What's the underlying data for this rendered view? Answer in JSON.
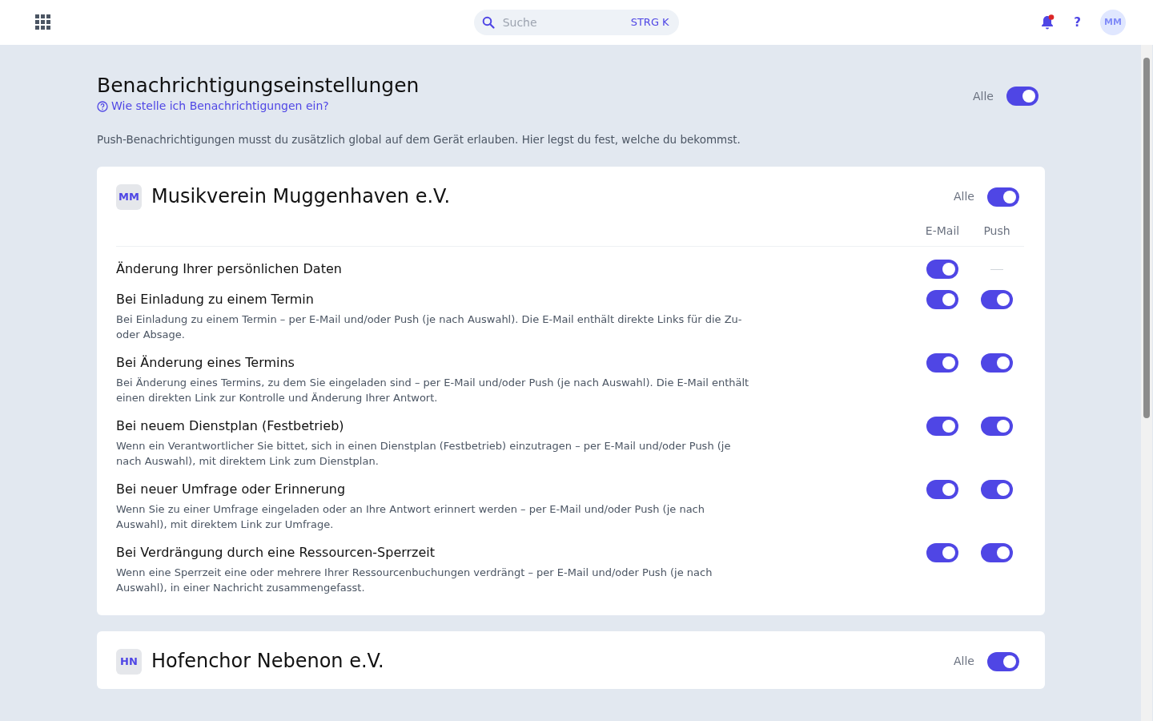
{
  "search": {
    "placeholder": "Suche",
    "shortcut": "STRG K"
  },
  "topbar": {
    "notifications_unread": true,
    "help": "?",
    "avatar": "MM"
  },
  "page": {
    "title": "Benachrichtigungseinstellungen",
    "help_link": "Wie stelle ich Benachrichtigungen ein?",
    "all_label": "Alle",
    "all_on": true,
    "intro": "Push-Benachrichtigungen musst du zusätzlich global auf dem Gerät erlauben. Hier legst du fest, welche du bekommst."
  },
  "groups": [
    {
      "initials": "MM",
      "name": "Musikverein Muggenhaven e.V.",
      "all_label": "Alle",
      "all_on": true,
      "columns": [
        "E-Mail",
        "Push"
      ],
      "rows": [
        {
          "title": "Änderung Ihrer persönlichen Daten",
          "email": true
        },
        {
          "title": "Bei Einladung zu einem Termin",
          "description": "Bei Einladung zu einem Termin – per E-Mail und/oder Push (je nach Auswahl). Die E-Mail enthält direkte Links für die Zu- oder Absage.",
          "email": true,
          "push": true
        },
        {
          "title": "Bei Änderung eines Termins",
          "description": "Bei Änderung eines Termins, zu dem Sie eingeladen sind – per E-Mail und/oder Push (je nach Auswahl). Die E-Mail enthält einen direkten Link zur Kontrolle und Änderung Ihrer Antwort.",
          "email": true,
          "push": true
        },
        {
          "title": "Bei neuem Dienstplan (Festbetrieb)",
          "description": "Wenn ein Verantwortlicher Sie bittet, sich in einen Dienstplan (Festbetrieb) einzutragen – per E-Mail und/oder Push (je nach Auswahl), mit direktem Link zum Dienstplan.",
          "email": true,
          "push": true
        },
        {
          "title": "Bei neuer Umfrage oder Erinnerung",
          "description": "Wenn Sie zu einer Umfrage eingeladen oder an Ihre Antwort erinnert werden – per E-Mail und/oder Push (je nach Auswahl), mit direktem Link zur Umfrage.",
          "email": true,
          "push": true
        },
        {
          "title": "Bei Verdrängung durch eine Ressourcen-Sperrzeit",
          "description": "Wenn eine Sperrzeit eine oder mehrere Ihrer Ressourcenbuchungen verdrängt – per E-Mail und/oder Push (je nach Auswahl), in einer Nachricht zusammengefasst.",
          "email": true,
          "push": true
        }
      ]
    },
    {
      "initials": "HN",
      "name": "Hofenchor Nebenon e.V.",
      "all_label": "Alle",
      "all_on": true
    }
  ]
}
